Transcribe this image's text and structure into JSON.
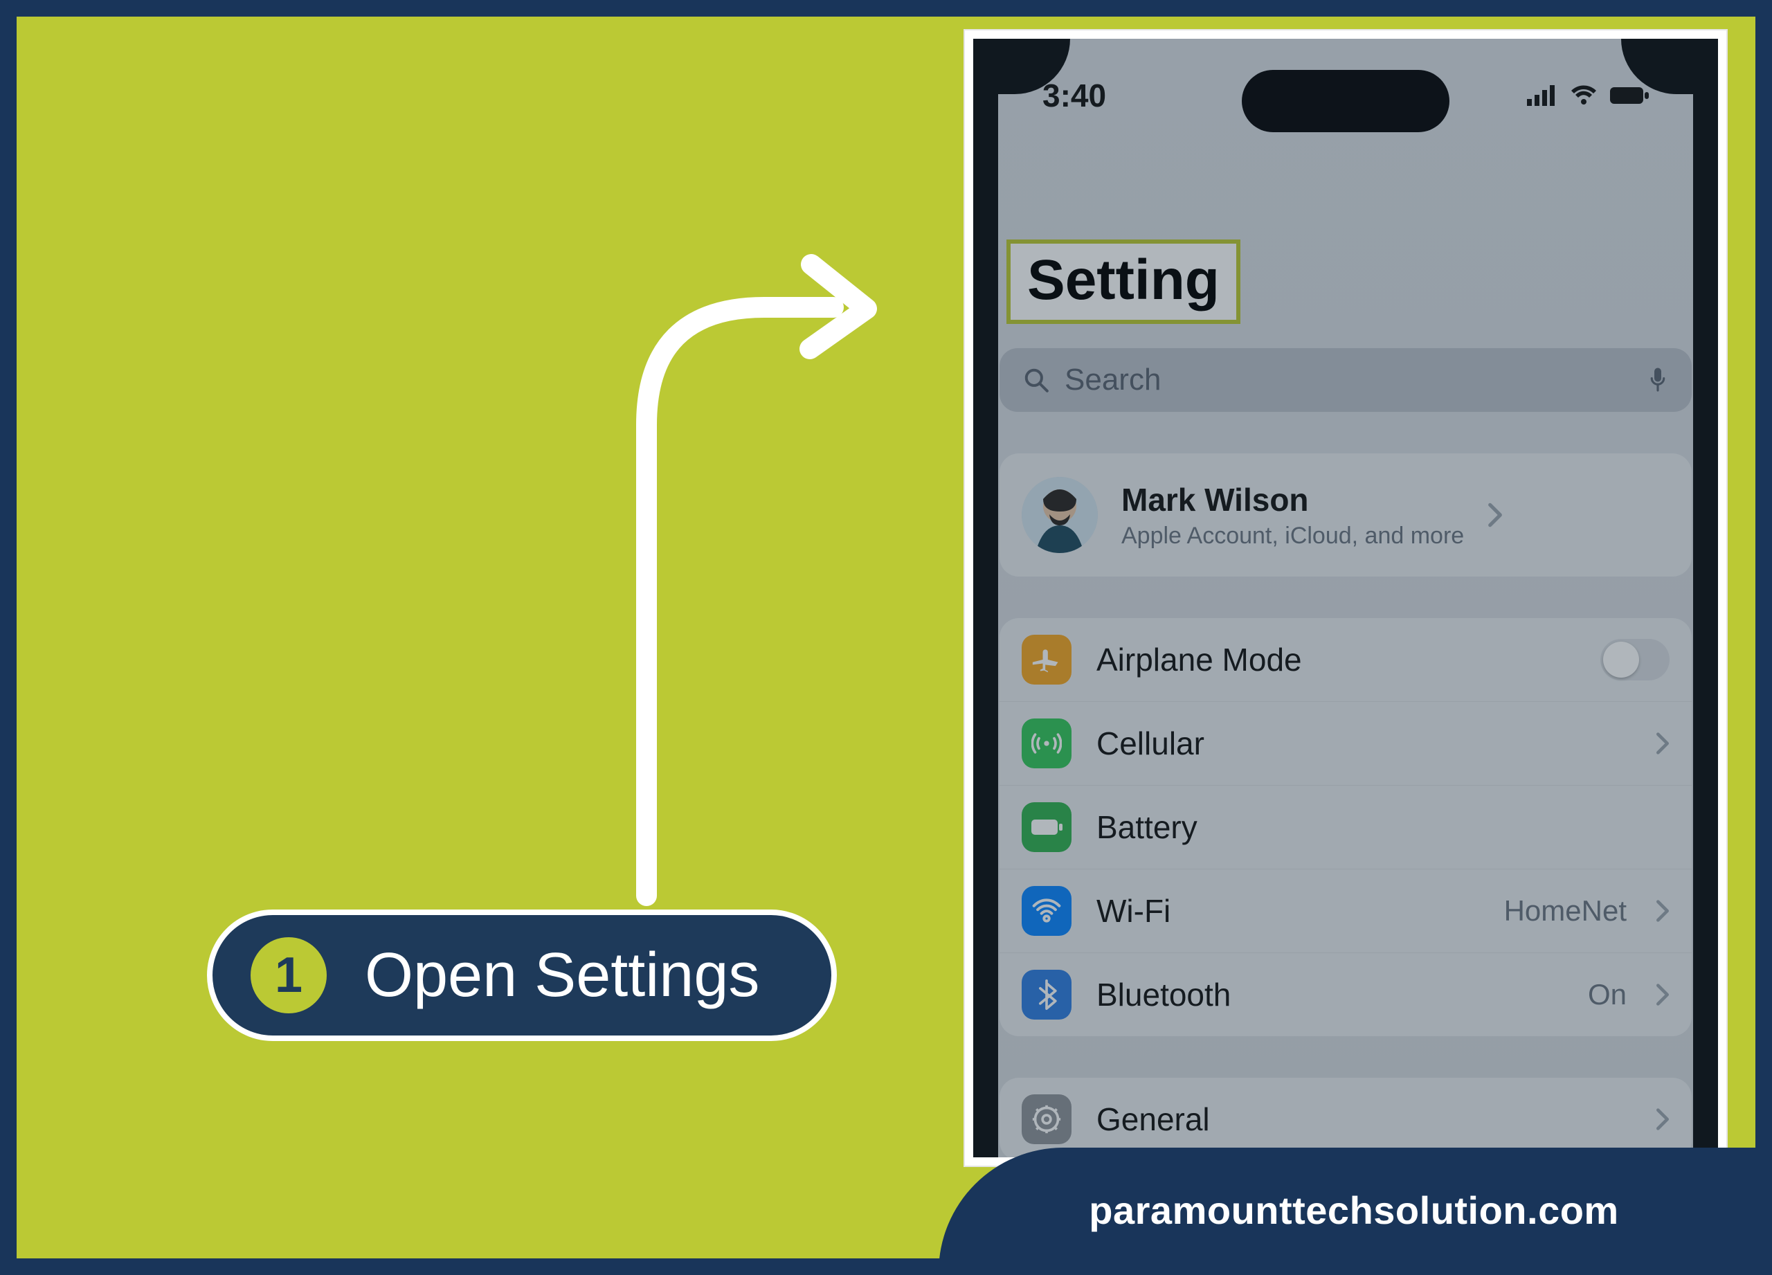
{
  "step": {
    "number": "1",
    "label": "Open Settings"
  },
  "phone": {
    "status": {
      "time": "3:40"
    },
    "title": "Setting",
    "search": {
      "placeholder": "Search"
    },
    "profile": {
      "name": "Mark Wilson",
      "subtitle": "Apple Account, iCloud, and more"
    },
    "rows_primary": [
      {
        "icon": "airplane-icon",
        "icon_color": "ic-orange",
        "label": "Airplane Mode",
        "value": "",
        "toggle": true,
        "chevron": false
      },
      {
        "icon": "cellular-icon",
        "icon_color": "ic-green",
        "label": "Cellular",
        "value": "",
        "toggle": false,
        "chevron": true
      },
      {
        "icon": "battery-icon",
        "icon_color": "ic-green2",
        "label": "Battery",
        "value": "",
        "toggle": false,
        "chevron": false
      },
      {
        "icon": "wifi-icon",
        "icon_color": "ic-blue",
        "label": "Wi-Fi",
        "value": "HomeNet",
        "toggle": false,
        "chevron": true
      },
      {
        "icon": "bluetooth-icon",
        "icon_color": "ic-blue2",
        "label": "Bluetooth",
        "value": "On",
        "toggle": false,
        "chevron": true
      }
    ],
    "rows_secondary": [
      {
        "icon": "gear-icon",
        "icon_color": "ic-gray",
        "label": "General",
        "value": "",
        "toggle": false,
        "chevron": true
      }
    ]
  },
  "footer": {
    "text": "paramounttechsolution.com"
  },
  "colors": {
    "frame": "#19355a",
    "bg": "#bbc934",
    "pill": "#1e3a5a"
  }
}
